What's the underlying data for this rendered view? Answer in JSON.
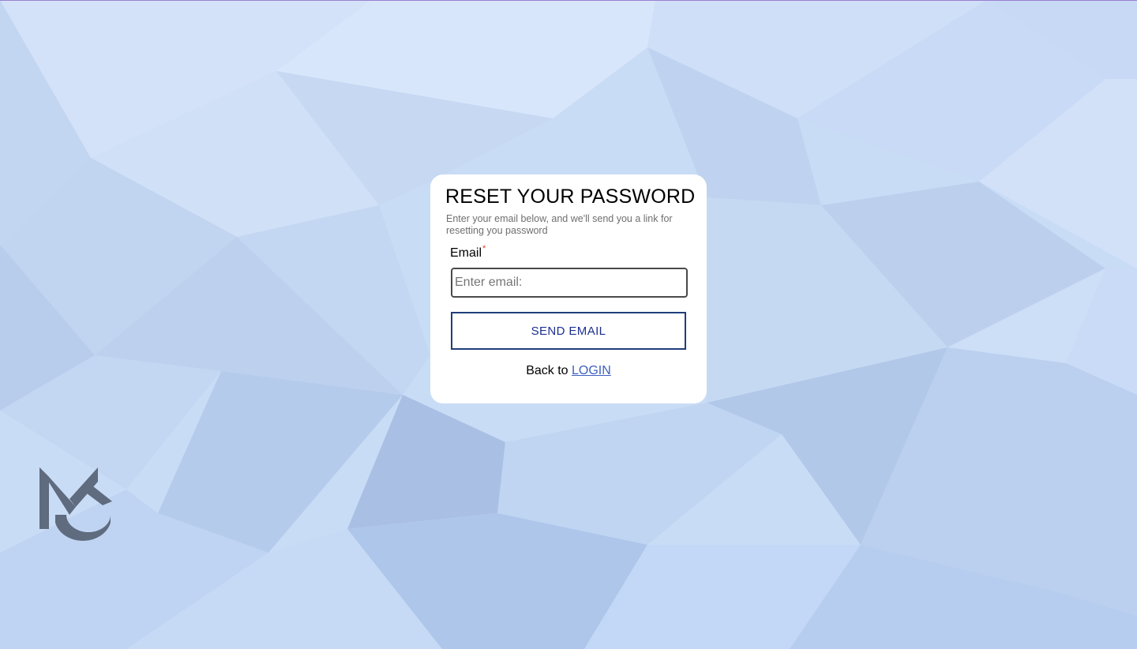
{
  "page": {
    "background_color": "#c9dcf6",
    "top_border_color": "#9b7fd0"
  },
  "card": {
    "title": "RESET YOUR PASSWORD",
    "subtitle": "Enter your email below, and we'll send you a link for resetting you password",
    "email_label": "Email",
    "required_marker": "*",
    "email_value": "",
    "email_placeholder": "Enter email:",
    "send_button_label": "SEND EMAIL",
    "back_text": "Back to",
    "login_link_label": "LOGIN",
    "accent_color": "#1c2f8f",
    "link_color": "#3d5fc0",
    "required_color": "#e53935"
  },
  "logo": {
    "icon": "mc-monogram-logo",
    "color": "#5f6b7e"
  }
}
